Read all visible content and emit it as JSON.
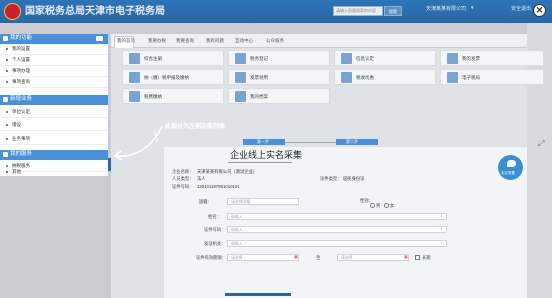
{
  "header": {
    "site_title": "国家税务总局天津市电子税务局",
    "search_placeholder": "请输入您要搜索的内容",
    "search_button": "搜索",
    "user_label": "天津某某有限公司",
    "user_arrow": "▾",
    "logout": "安全退出"
  },
  "close_icon_glyph": "✕",
  "sidebar": {
    "groups": [
      {
        "title": "我的功能",
        "items": [
          "我的设置",
          "个人设置",
          "事项办理",
          "事项查询"
        ]
      },
      {
        "title": "新增业务",
        "items": [
          "单位认定",
          "增设",
          "业务事项"
        ]
      },
      {
        "title": "我的服务",
        "items": [
          "纳税服务",
          "其他"
        ]
      }
    ]
  },
  "top_nav": {
    "tabs": [
      "我的首页",
      "我要办税",
      "我要查询",
      "我有问题",
      "互动中心",
      "公众服务"
    ]
  },
  "tiles": [
    [
      "综合注册",
      "税务登记",
      "信息认定",
      "我的发票"
    ],
    [
      "纳（缴）税申报及缴纳",
      "发票领用",
      "税收优惠",
      "电子税局"
    ],
    [
      "税费缴纳",
      "我的档案"
    ]
  ],
  "annotation": "此部分为左侧功能列表",
  "steps": {
    "step1": "第一步",
    "step2": "第二步"
  },
  "form": {
    "title": "企业线上实名采集",
    "company_label": "企业名称：",
    "company_value": "天津某某有限公司（测试企业）",
    "role_label": "人员类型：",
    "role_value": "法人",
    "idtype_label": "证件类型：",
    "idtype_value": "居民身份证",
    "id_label": "证件号码：",
    "id_value": "120101197801010101",
    "nation_label": "国籍：",
    "nation_placeholder": "请选择国籍",
    "gender_label": "性别：",
    "gender_options": [
      "男",
      "女"
    ],
    "name_label": "姓名：",
    "name_placeholder": "请输入...",
    "idno_label": "证件号码：",
    "idno_placeholder": "请输入...",
    "org_label": "发证机关：",
    "org_placeholder": "请输入...",
    "validity_label": "证件有效期限：",
    "validity_placeholder": "请选择",
    "validity_to": "至",
    "validity_long": "长期",
    "collect_button": "实名采集"
  }
}
